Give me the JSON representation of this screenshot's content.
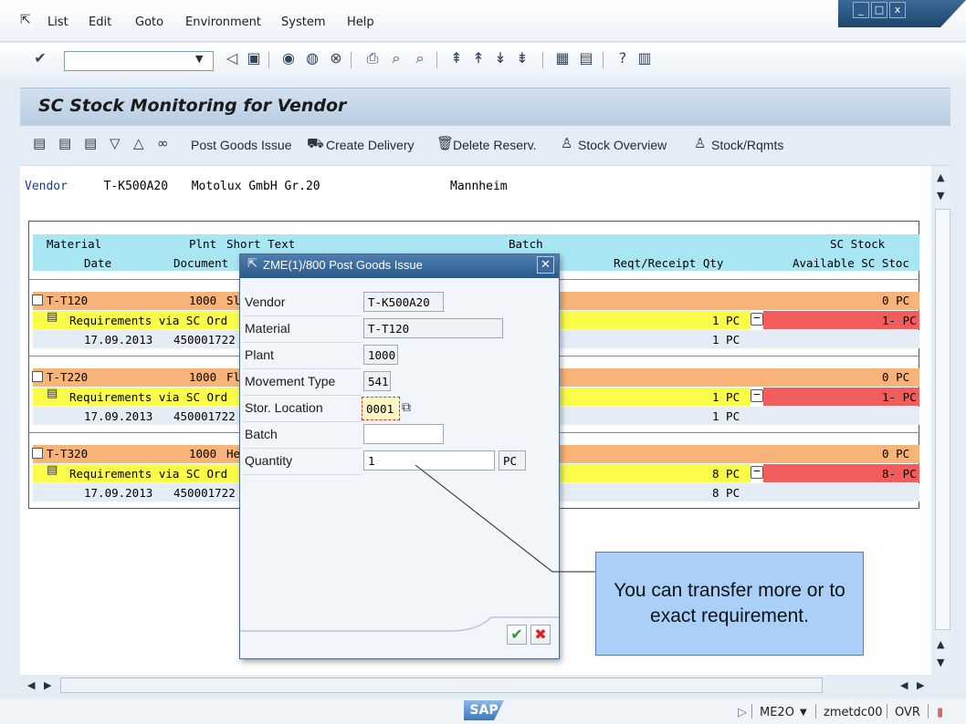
{
  "menubar": {
    "items": [
      {
        "label": "List"
      },
      {
        "label": "Edit"
      },
      {
        "label": "Goto"
      },
      {
        "label": "Environment"
      },
      {
        "label": "System"
      },
      {
        "label": "Help"
      }
    ]
  },
  "toolbar": {
    "command_field_value": ""
  },
  "screen": {
    "title": "SC Stock Monitoring for Vendor"
  },
  "app_toolbar": {
    "post_goods_issue": "Post Goods Issue",
    "create_delivery": "Create Delivery",
    "delete_reserv": "Delete Reserv.",
    "stock_overview": "Stock Overview",
    "stock_rqmts": "Stock/Rqmts"
  },
  "vendor_line": {
    "label": "Vendor",
    "id": "T-K500A20",
    "name": "Motolux GmbH Gr.20",
    "city": "Mannheim"
  },
  "grid": {
    "header1": {
      "material": "Material",
      "plnt": "Plnt",
      "short_text": "Short Text",
      "batch": "Batch",
      "sc_stock": "SC Stock"
    },
    "header2": {
      "date": "Date",
      "document": "Document",
      "reqt_qty": "Reqt/Receipt Qty",
      "avail": "Available SC Stoc"
    },
    "groups": [
      {
        "material": "T-T120",
        "plant": "1000",
        "short": "Sl",
        "sc_stock": "0",
        "sc_unit": "PC",
        "req_text": "Requirements via SC Ord",
        "req_qty": "1 PC",
        "avail": "1-",
        "avail_unit": "PC",
        "date": "17.09.2013",
        "doc": "450001722",
        "line_qty": "1 PC"
      },
      {
        "material": "T-T220",
        "plant": "1000",
        "short": "Fl",
        "sc_stock": "0",
        "sc_unit": "PC",
        "req_text": "Requirements via SC Ord",
        "req_qty": "1 PC",
        "avail": "1-",
        "avail_unit": "PC",
        "date": "17.09.2013",
        "doc": "450001722",
        "line_qty": "1 PC"
      },
      {
        "material": "T-T320",
        "plant": "1000",
        "short": "He",
        "sc_stock": "0",
        "sc_unit": "PC",
        "req_text": "Requirements via SC Ord",
        "req_qty": "8 PC",
        "avail": "8-",
        "avail_unit": "PC",
        "date": "17.09.2013",
        "doc": "450001722",
        "line_qty": "8 PC"
      }
    ]
  },
  "popup": {
    "title": "ZME(1)/800 Post Goods Issue",
    "fields": {
      "vendor": {
        "label": "Vendor",
        "value": "T-K500A20"
      },
      "material": {
        "label": "Material",
        "value": "T-T120"
      },
      "plant": {
        "label": "Plant",
        "value": "1000"
      },
      "movement_type": {
        "label": "Movement Type",
        "value": "541"
      },
      "stor_location": {
        "label": "Stor. Location",
        "value": "0001"
      },
      "batch": {
        "label": "Batch",
        "value": ""
      },
      "quantity": {
        "label": "Quantity",
        "value": "1",
        "unit": "PC"
      }
    }
  },
  "callout": {
    "text": "You can transfer more or to exact requirement."
  },
  "statusbar": {
    "logo": "SAP",
    "transaction": "ME2O",
    "server": "zmetdc00",
    "mode": "OVR"
  },
  "colors": {
    "header_cyan": "#a8e6f4",
    "row_orange": "#f8b478",
    "row_yellow": "#fbfb4a",
    "row_red": "#f25c5c",
    "callout_blue": "#aad0f8"
  }
}
